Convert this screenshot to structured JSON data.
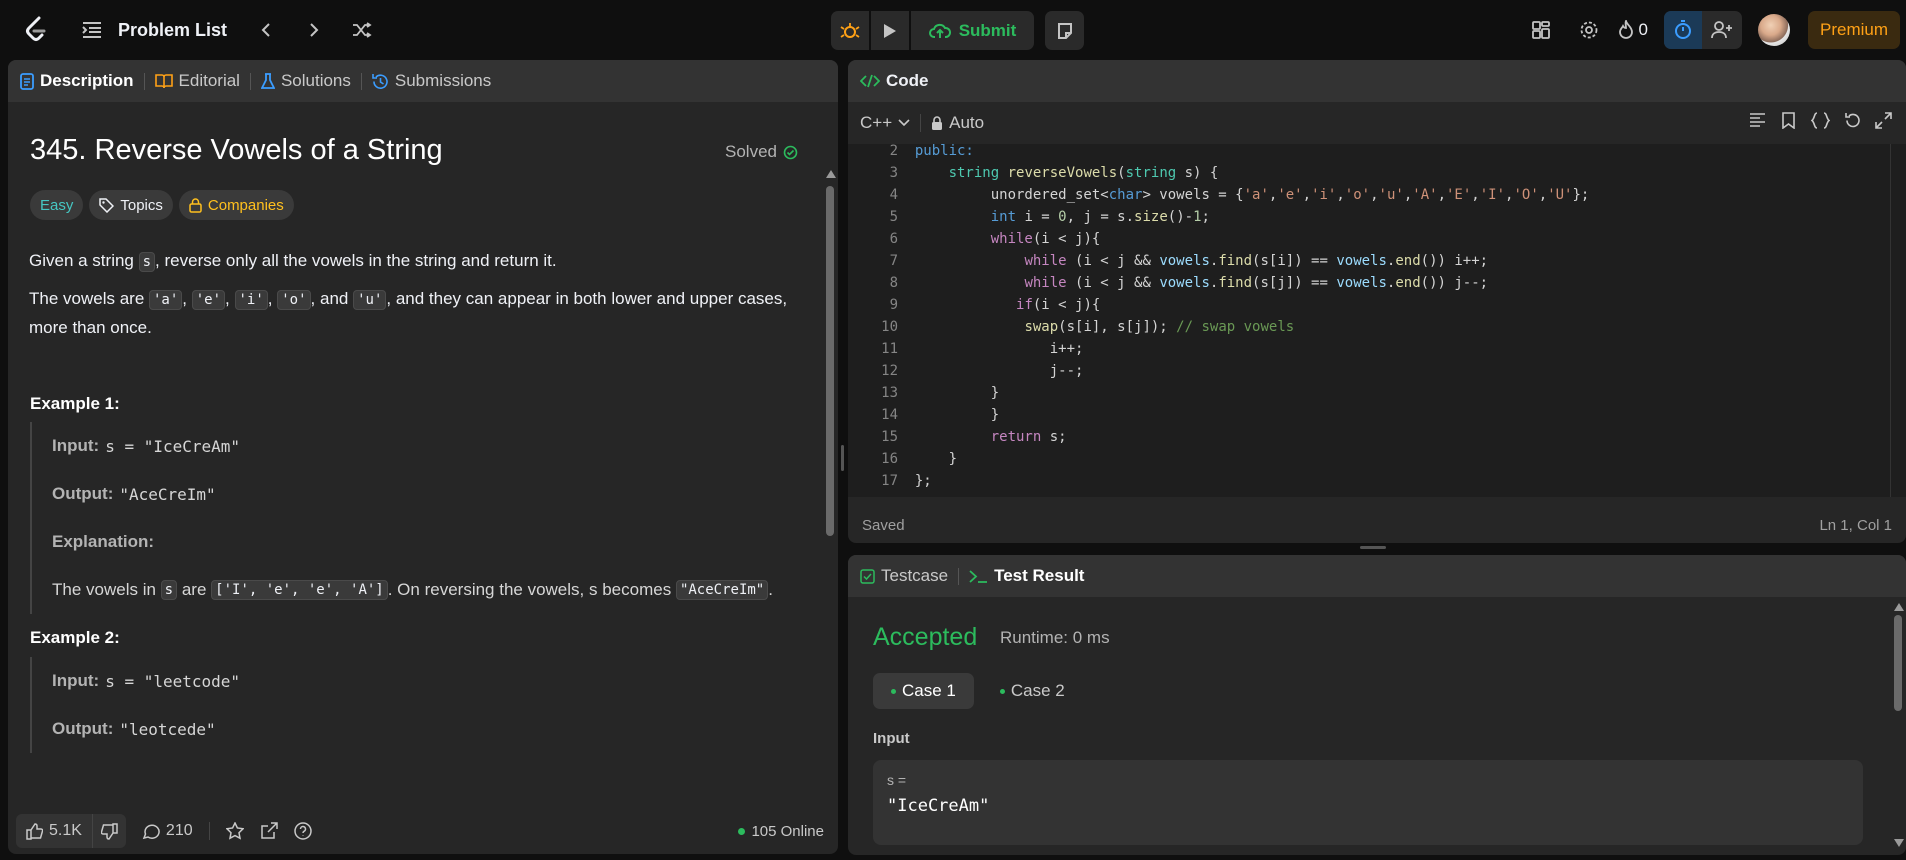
{
  "topbar": {
    "title": "Problem List",
    "submit_label": "Submit",
    "streak_count": "0",
    "premium_label": "Premium"
  },
  "description_panel": {
    "tabs": [
      {
        "label": "Description"
      },
      {
        "label": "Editorial"
      },
      {
        "label": "Solutions"
      },
      {
        "label": "Submissions"
      }
    ],
    "problem_title": "345. Reverse Vowels of a String",
    "solved_label": "Solved",
    "tags": {
      "difficulty": "Easy",
      "topics": "Topics",
      "companies": "Companies"
    },
    "desc1_pre": "Given a string ",
    "desc1_code": "s",
    "desc1_post": ", reverse only all the vowels in the string and return it.",
    "desc2_pre": "The vowels are ",
    "vowels": [
      "'a'",
      "'e'",
      "'i'",
      "'o'",
      "'u'"
    ],
    "desc2_and": ", and ",
    "desc2_post": ", and they can appear in both lower and upper cases, more than once.",
    "example1": {
      "title": "Example 1:",
      "input_label": "Input:",
      "input_value": "s = \"IceCreAm\"",
      "output_label": "Output:",
      "output_value": "\"AceCreIm\"",
      "explanation_label": "Explanation:",
      "expl_pre": "The vowels in ",
      "expl_code1": "s",
      "expl_mid": " are ",
      "expl_code2": "['I', 'e', 'e', 'A']",
      "expl_mid2": ". On reversing the vowels, s becomes ",
      "expl_code3": "\"AceCreIm\"",
      "expl_end": "."
    },
    "example2": {
      "title": "Example 2:",
      "input_label": "Input:",
      "input_value": "s = \"leetcode\"",
      "output_label": "Output:",
      "output_value": "\"leotcede\""
    },
    "footer": {
      "likes": "5.1K",
      "comments": "210",
      "online": "105 Online"
    }
  },
  "code_panel": {
    "title": "Code",
    "language": "C++",
    "mode": "Auto",
    "status": "Saved",
    "cursor": "Ln 1, Col 1",
    "line_numbers": [
      "2",
      "3",
      "4",
      "5",
      "6",
      "7",
      "8",
      "9",
      "10",
      "11",
      "12",
      "13",
      "14",
      "15",
      "16",
      "17"
    ]
  },
  "result_panel": {
    "tabs": [
      {
        "label": "Testcase"
      },
      {
        "label": "Test Result"
      }
    ],
    "verdict": "Accepted",
    "runtime": "Runtime: 0 ms",
    "cases": [
      {
        "label": "Case 1"
      },
      {
        "label": "Case 2"
      }
    ],
    "input_label": "Input",
    "var_name": "s =",
    "var_value": "\"IceCreAm\""
  },
  "colors": {
    "accent_green": "#2cbb5d",
    "easy_teal": "#46c6c2",
    "premium_orange": "#ffa116",
    "timer_blue": "#3b9dff"
  }
}
